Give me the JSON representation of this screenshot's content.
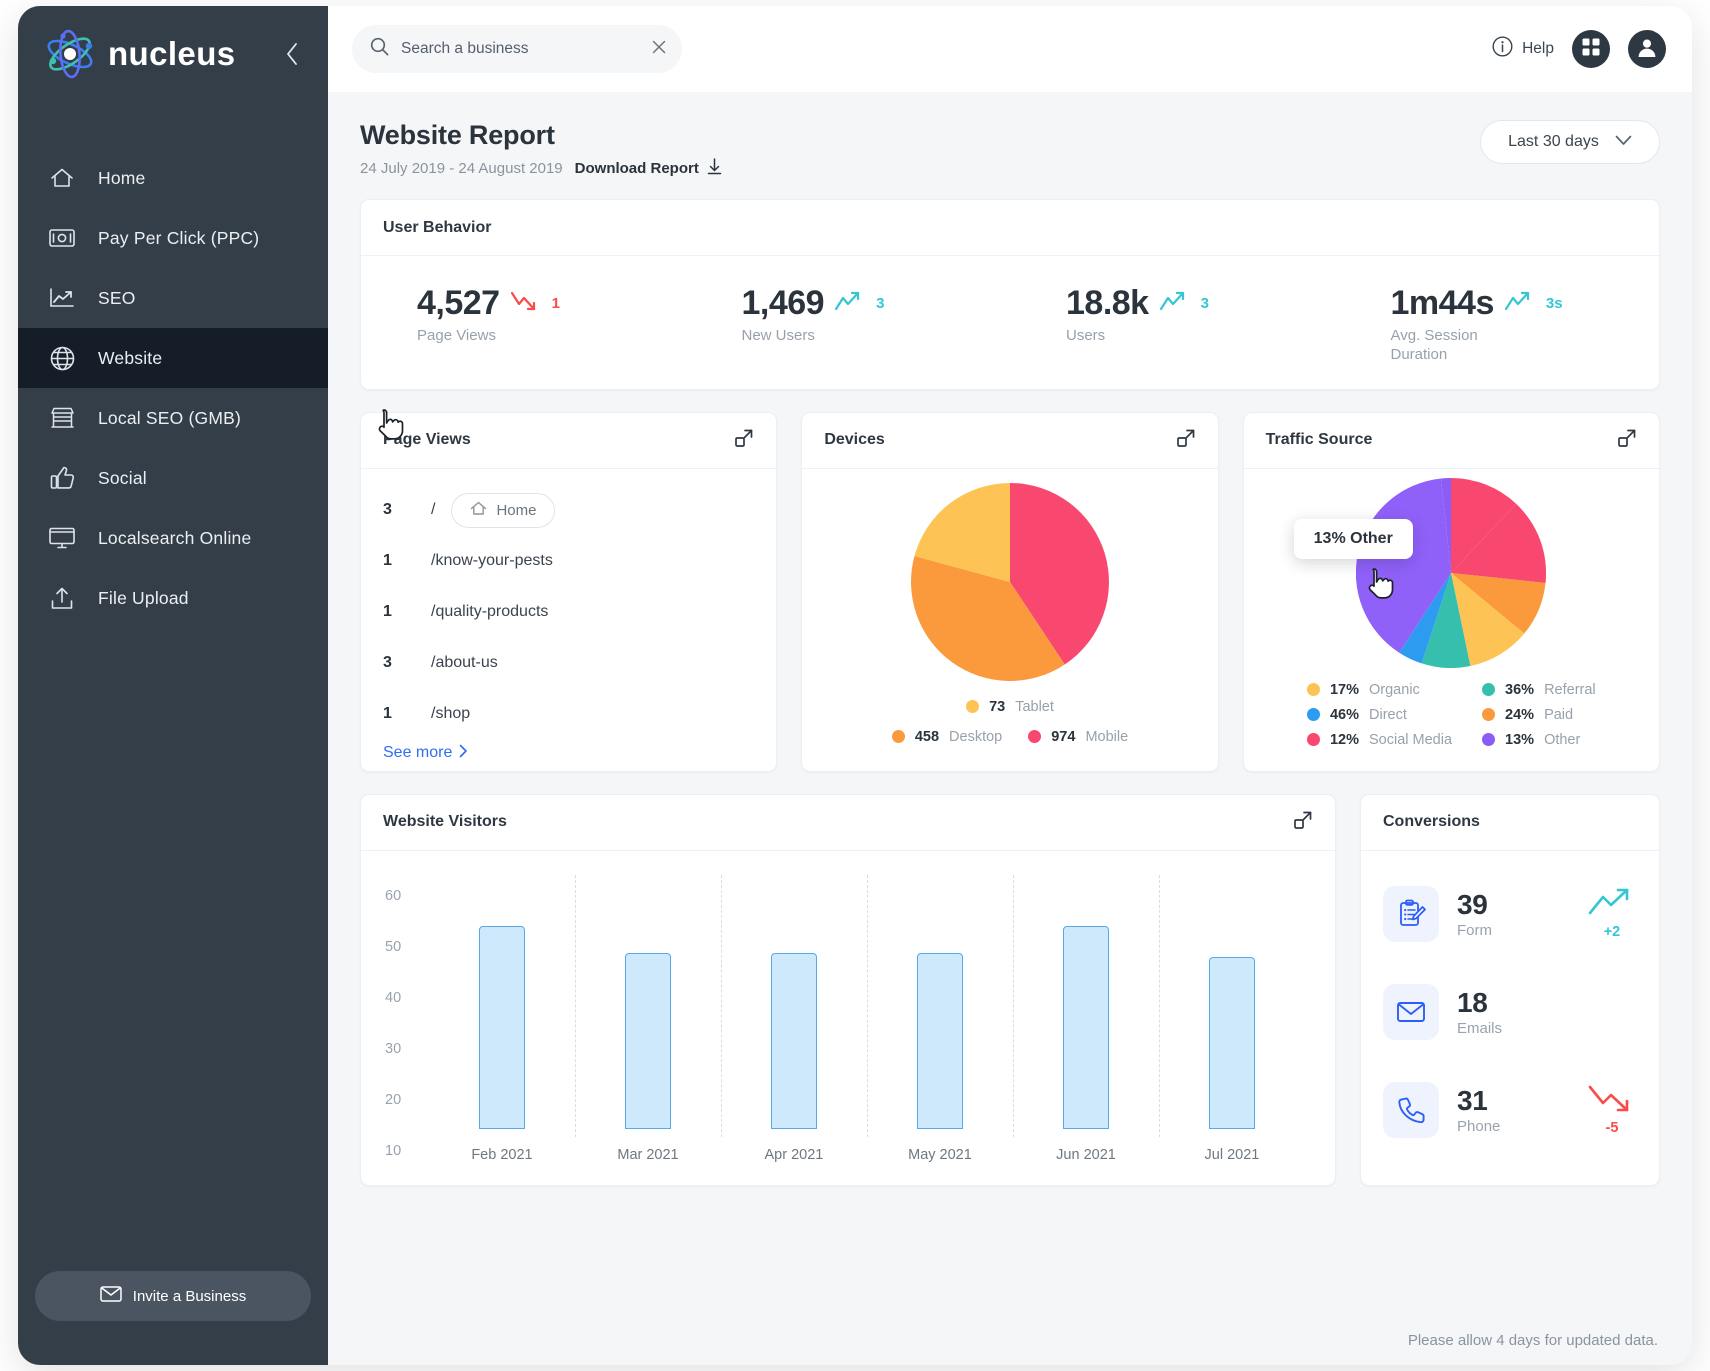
{
  "brand": {
    "name": "nucleus",
    "logo_icon": "atom-icon",
    "collapse_icon": "chevron-left-icon"
  },
  "sidebar": {
    "items": [
      {
        "label": "Home",
        "icon": "home-icon",
        "active": false
      },
      {
        "label": "Pay Per Click (PPC)",
        "icon": "money-icon",
        "active": false
      },
      {
        "label": "SEO",
        "icon": "line-chart-icon",
        "active": false
      },
      {
        "label": "Website",
        "icon": "globe-icon",
        "active": true
      },
      {
        "label": "Local SEO (GMB)",
        "icon": "storefront-icon",
        "active": false
      },
      {
        "label": "Social",
        "icon": "thumbs-up-icon",
        "active": false
      },
      {
        "label": "Localsearch Online",
        "icon": "monitor-icon",
        "active": false
      },
      {
        "label": "File Upload",
        "icon": "upload-icon",
        "active": false
      }
    ],
    "invite_label": "Invite a Business",
    "invite_icon": "envelope-icon"
  },
  "topbar": {
    "search_placeholder": "Search a business",
    "search_value": "",
    "search_icon": "search-icon",
    "clear_icon": "close-icon",
    "help_label": "Help",
    "help_icon": "info-icon",
    "apps_icon": "grid-apps-icon",
    "account_icon": "user-avatar-icon"
  },
  "page": {
    "title": "Website Report",
    "date_range": "24 July 2019 - 24 August 2019",
    "download_label": "Download Report",
    "download_icon": "download-icon",
    "range_select_value": "Last 30 days",
    "range_select_icon": "chevron-down-icon",
    "footnote": "Please allow 4 days for updated data."
  },
  "user_behavior": {
    "title": "User Behavior",
    "stats": [
      {
        "value": "4,527",
        "label": "Page Views",
        "delta": "1",
        "trend": "down",
        "color": "#fb4a4a"
      },
      {
        "value": "1,469",
        "label": "New Users",
        "delta": "3",
        "trend": "up",
        "color": "#35c6d4"
      },
      {
        "value": "18.8k",
        "label": "Users",
        "delta": "3",
        "trend": "up",
        "color": "#35c6d4"
      },
      {
        "value": "1m44s",
        "label": "Avg. Session Duration",
        "delta": "3s",
        "trend": "up",
        "color": "#35c6d4"
      }
    ]
  },
  "page_views": {
    "title": "Page Views",
    "expand_icon": "expand-icon",
    "rows": [
      {
        "count": "3",
        "path": "/",
        "chip": "Home",
        "chip_icon": "home-icon"
      },
      {
        "count": "1",
        "path": "/know-your-pests",
        "chip": null
      },
      {
        "count": "1",
        "path": "/quality-products",
        "chip": null
      },
      {
        "count": "3",
        "path": "/about-us",
        "chip": null
      },
      {
        "count": "1",
        "path": "/shop",
        "chip": null
      }
    ],
    "see_more": "See more",
    "see_more_icon": "chevron-right-icon"
  },
  "chart_data": [
    {
      "type": "pie",
      "title": "Devices",
      "labels": [
        "Mobile",
        "Desktop",
        "Tablet"
      ],
      "values": [
        974,
        458,
        73
      ],
      "colors": [
        "#f9486f",
        "#fa9a3c",
        "#fdc košík"
      ],
      "legend_position": "bottom",
      "legend": [
        {
          "value": "73",
          "name": "Tablet",
          "color": "#fdc455"
        },
        {
          "value": "458",
          "name": "Desktop",
          "color": "#fa9a3c"
        },
        {
          "value": "974",
          "name": "Mobile",
          "color": "#f9486f"
        }
      ]
    },
    {
      "type": "pie",
      "title": "Traffic Source",
      "labels": [
        "Social Media",
        "Paid",
        "Referral",
        "Organic",
        "Direct",
        "Other"
      ],
      "values": [
        12,
        24,
        36,
        17,
        46,
        13
      ],
      "legend_position": "bottom",
      "tooltip": "13% Other",
      "legend": [
        {
          "value": "17%",
          "name": "Organic",
          "color": "#fdc455"
        },
        {
          "value": "36%",
          "name": "Referral",
          "color": "#37bfad"
        },
        {
          "value": "46%",
          "name": "Direct",
          "color": "#2d9cf0"
        },
        {
          "value": "24%",
          "name": "Paid",
          "color": "#fa9a3c"
        },
        {
          "value": "12%",
          "name": "Social Media",
          "color": "#f9486f"
        },
        {
          "value": "13%",
          "name": "Other",
          "color": "#8b5cf6"
        }
      ]
    },
    {
      "type": "bar",
      "title": "Website Visitors",
      "categories": [
        "Feb 2021",
        "Mar 2021",
        "Apr 2021",
        "May 2021",
        "Jun 2021",
        "Jul 2021"
      ],
      "values": [
        52,
        45,
        45,
        45,
        52,
        44
      ],
      "ylim": [
        0,
        64
      ],
      "yticks": [
        10,
        20,
        30,
        40,
        50,
        60
      ],
      "xlabel": "",
      "ylabel": "",
      "grid": true
    }
  ],
  "devices": {
    "title": "Devices",
    "expand_icon": "expand-icon"
  },
  "traffic": {
    "title": "Traffic Source",
    "expand_icon": "expand-icon"
  },
  "visitors": {
    "title": "Website Visitors",
    "expand_icon": "expand-icon"
  },
  "conversions": {
    "title": "Conversions",
    "rows": [
      {
        "value": "39",
        "label": "Form",
        "delta": "+2",
        "trend": "up",
        "icon": "clipboard-form-icon",
        "color": "#35c6d4"
      },
      {
        "value": "18",
        "label": "Emails",
        "delta": "",
        "trend": "none",
        "icon": "envelope-icon",
        "color": ""
      },
      {
        "value": "31",
        "label": "Phone",
        "delta": "-5",
        "trend": "down",
        "icon": "phone-icon",
        "color": "#fb4a4a"
      }
    ]
  }
}
